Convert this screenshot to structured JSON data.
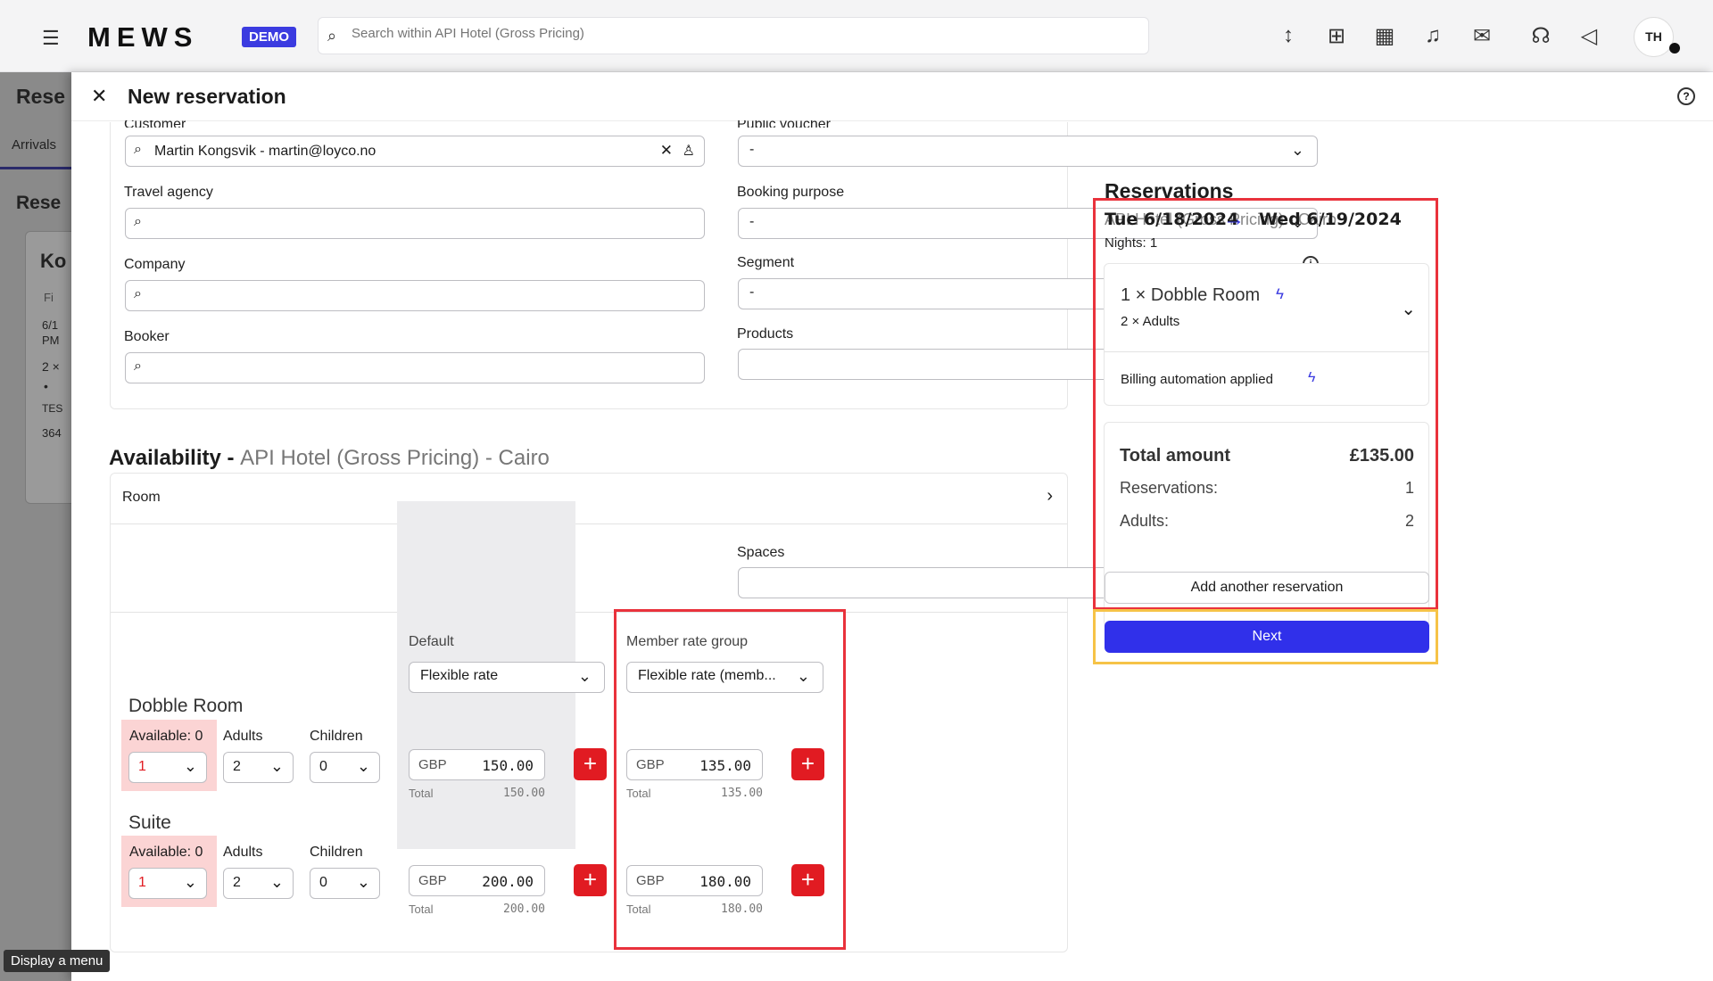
{
  "topbar": {
    "logo": "MEWS",
    "badge": "DEMO",
    "search_placeholder": "Search within API Hotel (Gross Pricing)",
    "avatar": "TH"
  },
  "background": {
    "title": "Rese",
    "tab": "Arrivals",
    "sub": "Rese",
    "card_head": "Ko",
    "lines": [
      "Fi",
      "6/1",
      "PM",
      "2 ×",
      "•",
      "TES",
      "364"
    ]
  },
  "modal": {
    "title": "New reservation",
    "fields": {
      "customer_label": "Customer",
      "customer_value": "Martin Kongsvik - martin@loyco.no",
      "travel_agency_label": "Travel agency",
      "company_label": "Company",
      "booker_label": "Booker",
      "voucher_label": "Public voucher",
      "voucher_value": "-",
      "booking_purpose_label": "Booking purpose",
      "booking_purpose_value": "-",
      "segment_label": "Segment",
      "segment_value": "-",
      "products_label": "Products"
    }
  },
  "availability": {
    "title": "Availability - ",
    "hotel": "API Hotel (Gross Pricing) - Cairo",
    "room_label": "Room",
    "spaces_label": "Spaces",
    "default_label": "Default",
    "default_rate": "Flexible rate",
    "member_label": "Member rate group",
    "member_rate": "Flexible rate (memb...",
    "adults_label": "Adults",
    "children_label": "Children",
    "total_label": "Total",
    "rooms": [
      {
        "name": "Dobble Room",
        "available": "Available: 0",
        "qty": "1",
        "adults": "2",
        "children": "0",
        "cur": "GBP",
        "default_price": "150.00",
        "default_total": "150.00",
        "member_price": "135.00",
        "member_total": "135.00"
      },
      {
        "name": "Suite",
        "available": "Available: 0",
        "qty": "1",
        "adults": "2",
        "children": "0",
        "cur": "GBP",
        "default_price": "200.00",
        "default_total": "200.00",
        "member_price": "180.00",
        "member_total": "180.00"
      }
    ]
  },
  "summary": {
    "title": "Reservations",
    "hotel": "API Hotel (Gross Pricing) - Cairo",
    "date_from": "Tue 6/18/2024",
    "date_to": "Wed 6/19/2024",
    "nights": "Nights: 1",
    "room_line": "1 × Dobble Room",
    "adults_line": "2 × Adults",
    "billing": "Billing automation applied",
    "total_label": "Total amount",
    "total_value": "£135.00",
    "reservations_label": "Reservations:",
    "reservations_value": "1",
    "adults_label": "Adults:",
    "adults_value": "2",
    "add_button": "Add another reservation",
    "next_button": "Next"
  },
  "tooltip": "Display a menu",
  "colors": {
    "accent": "#3030ea",
    "danger": "#e11b22",
    "highlight_red": "#e9323c",
    "highlight_yellow": "#f6c347"
  }
}
